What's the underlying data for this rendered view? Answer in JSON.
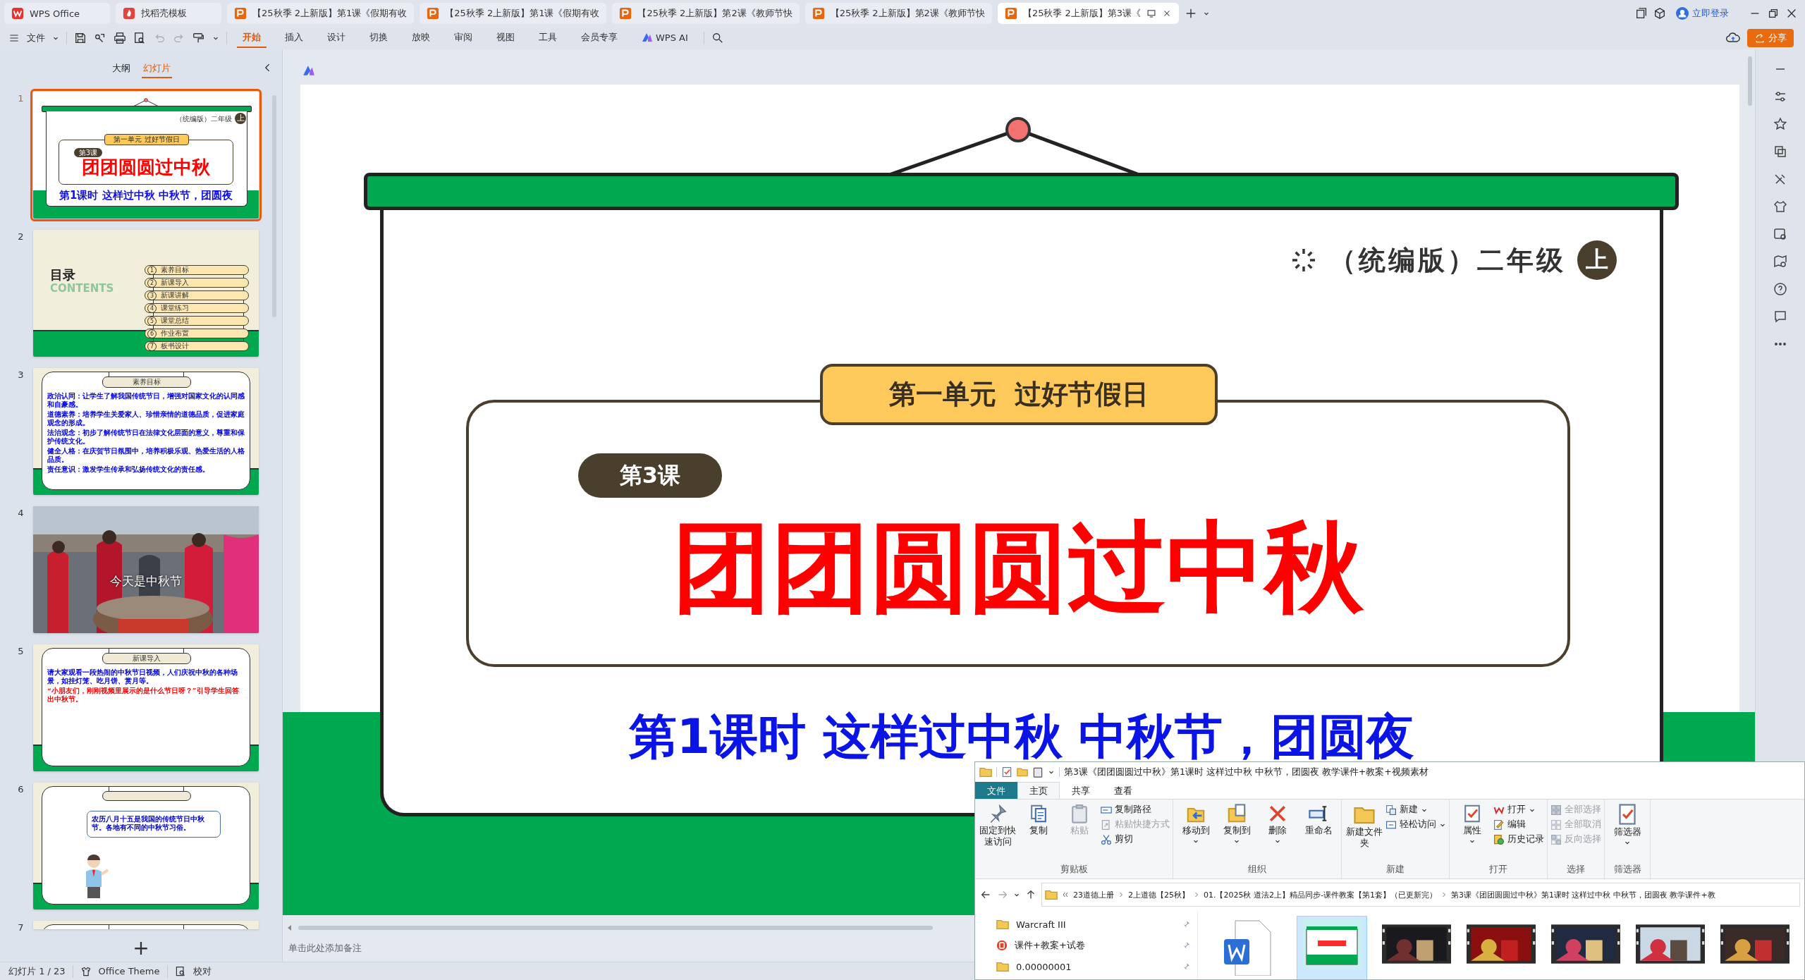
{
  "tabs": [
    {
      "label": "WPS Office",
      "kind": "app",
      "selected": false
    },
    {
      "label": "找稻壳模板",
      "kind": "template",
      "selected": false
    },
    {
      "label": "【25秋季 2上新版】第1课《假期有收",
      "kind": "doc",
      "selected": false
    },
    {
      "label": "【25秋季 2上新版】第1课《假期有收",
      "kind": "doc",
      "selected": false
    },
    {
      "label": "【25秋季 2上新版】第2课《教师节快",
      "kind": "doc",
      "selected": false
    },
    {
      "label": "【25秋季 2上新版】第2课《教师节快",
      "kind": "doc",
      "selected": false
    },
    {
      "label": "【25秋季 2上新版】第3课《",
      "kind": "doc",
      "selected": true
    }
  ],
  "toolbar": {
    "file_menu": "文件",
    "menus": [
      {
        "label": "开始",
        "selected": true
      },
      {
        "label": "插入",
        "selected": false
      },
      {
        "label": "设计",
        "selected": false
      },
      {
        "label": "切换",
        "selected": false
      },
      {
        "label": "放映",
        "selected": false
      },
      {
        "label": "审阅",
        "selected": false
      },
      {
        "label": "视图",
        "selected": false
      },
      {
        "label": "工具",
        "selected": false
      },
      {
        "label": "会员专享",
        "selected": false
      },
      {
        "label": "WPS AI",
        "selected": false
      }
    ],
    "login": "立即登录",
    "share": "分享"
  },
  "slide_panel": {
    "views": [
      {
        "label": "大纲",
        "selected": false
      },
      {
        "label": "幻灯片",
        "selected": true
      }
    ],
    "slides": [
      {
        "number": "1",
        "kind": "cover",
        "selected": true,
        "grade": "（统编版）二年级",
        "term": "上",
        "unit": "第一单元  过好节假日",
        "lesson": "第3课",
        "title": "团团圆圆过中秋",
        "subtitle": "第1课时 这样过中秋 中秋节，团圆夜"
      },
      {
        "number": "2",
        "kind": "contents",
        "selected": false,
        "heading": "目录",
        "heading_en": "CONTENTS",
        "items": [
          {
            "num": "1",
            "label": "素养目标"
          },
          {
            "num": "2",
            "label": "新课导入"
          },
          {
            "num": "3",
            "label": "新课讲解"
          },
          {
            "num": "4",
            "label": "课堂练习"
          },
          {
            "num": "5",
            "label": "课堂总结"
          },
          {
            "num": "6",
            "label": "作业布置"
          },
          {
            "num": "7",
            "label": "板书设计"
          }
        ]
      },
      {
        "number": "3",
        "kind": "lines",
        "selected": false,
        "label": "素养目标",
        "lines": [
          {
            "text": "政治认同：让学生了解我国传统节日，增强对国家文化的认同感和自豪感。",
            "color": "#0000ee"
          },
          {
            "text": "道德素养：培养学生关爱家人、珍惜亲情的道德品质，促进家庭观念的形成。",
            "color": "#0000ee"
          },
          {
            "text": "法治观念：初步了解传统节日在法律文化层面的意义，尊重和保护传统文化。",
            "color": "#0000ee"
          },
          {
            "text": "健全人格：在庆贺节日氛围中，培养积极乐观、热爱生活的人格品质。",
            "color": "#0000ee"
          },
          {
            "text": "责任意识：激发学生传承和弘扬传统文化的责任感。",
            "color": "#0000ee"
          }
        ]
      },
      {
        "number": "4",
        "selected": false,
        "caption": "今天是中秋节"
      },
      {
        "number": "5",
        "kind": "lines",
        "selected": false,
        "label": "新课导入",
        "lines": [
          {
            "text": "请大家观看一段热闹的中秋节日视频，人们庆祝中秋的各种场景，如挂灯笼、吃月饼、赏月等。",
            "color": "#0000ee"
          },
          {
            "text": "“小朋友们，刚刚视频里展示的是什么节日呀？”引导学生回答出中秋节。",
            "color": "#ff0000"
          }
        ]
      },
      {
        "number": "6",
        "kind": "dialog",
        "selected": false,
        "bubble": "农历八月十五是我国的传统节日中秋节。各地有不同的中秋节习俗。"
      },
      {
        "number": "7",
        "kind": "partial",
        "selected": false
      }
    ],
    "add_button": "+"
  },
  "slide": {
    "grade": "（统编版）二年级",
    "term": "上",
    "unit": "第一单元  过好节假日",
    "lesson": "第3课",
    "title": "团团圆圆过中秋",
    "subtitle": "第1课时 这样过中秋 中秋节，团圆夜"
  },
  "notes_placeholder": "单击此处添加备注",
  "status_bar": {
    "slide_count": "幻灯片 1 / 23",
    "theme": "Office Theme",
    "proofing": "校对"
  },
  "explorer": {
    "title": "第3课《团团圆圆过中秋》第1课时 这样过中秋 中秋节，团圆夜 教学课件+教案+视频素材",
    "tabs": [
      {
        "label": "文件",
        "kind": "file",
        "selected": false
      },
      {
        "label": "主页",
        "kind": "tab",
        "selected": true
      },
      {
        "label": "共享",
        "kind": "tab",
        "selected": false
      },
      {
        "label": "查看",
        "kind": "tab",
        "selected": false
      }
    ],
    "groups": [
      {
        "label": "剪贴板",
        "items": [
          {
            "label": "固定到快速访问",
            "kind": "large",
            "disabled": false,
            "dropdown": false
          },
          {
            "label": "复制",
            "kind": "large",
            "disabled": false,
            "dropdown": false
          },
          {
            "label": "粘贴",
            "kind": "large",
            "disabled": true,
            "dropdown": false
          },
          {
            "label": "复制路径",
            "kind": "small",
            "disabled": false,
            "dropdown": false
          },
          {
            "label": "粘贴快捷方式",
            "kind": "small",
            "disabled": true,
            "dropdown": false
          },
          {
            "label": "剪切",
            "kind": "small",
            "disabled": false,
            "dropdown": false
          }
        ]
      },
      {
        "label": "组织",
        "items": [
          {
            "label": "移动到",
            "kind": "large",
            "disabled": false,
            "dropdown": true
          },
          {
            "label": "复制到",
            "kind": "large",
            "disabled": false,
            "dropdown": true
          },
          {
            "label": "删除",
            "kind": "large",
            "disabled": false,
            "dropdown": true
          },
          {
            "label": "重命名",
            "kind": "large",
            "disabled": false,
            "dropdown": false
          }
        ]
      },
      {
        "label": "新建",
        "items": [
          {
            "label": "新建文件夹",
            "kind": "large",
            "disabled": false,
            "dropdown": false
          },
          {
            "label": "新建",
            "kind": "small",
            "disabled": false,
            "dropdown": true
          },
          {
            "label": "轻松访问",
            "kind": "small",
            "disabled": false,
            "dropdown": true
          }
        ]
      },
      {
        "label": "打开",
        "items": [
          {
            "label": "属性",
            "kind": "large",
            "disabled": false,
            "dropdown": true
          },
          {
            "label": "打开",
            "kind": "small",
            "disabled": false,
            "dropdown": true
          },
          {
            "label": "编辑",
            "kind": "small",
            "disabled": false,
            "dropdown": false
          },
          {
            "label": "历史记录",
            "kind": "small",
            "disabled": false,
            "dropdown": false
          }
        ]
      },
      {
        "label": "选择",
        "items": [
          {
            "label": "全部选择",
            "kind": "small",
            "disabled": true,
            "dropdown": false
          },
          {
            "label": "全部取消",
            "kind": "small",
            "disabled": true,
            "dropdown": false
          },
          {
            "label": "反向选择",
            "kind": "small",
            "disabled": true,
            "dropdown": false
          }
        ]
      },
      {
        "label": "筛选器",
        "items": [
          {
            "label": "筛选器",
            "kind": "large",
            "disabled": false,
            "dropdown": true
          }
        ]
      }
    ],
    "breadcrumb": [
      "23道德上册",
      "2上道德【25秋】",
      "01.【2025秋 道法2上】精品同步-课件教案【第1套】（已更新完）",
      "第3课《团团圆圆过中秋》第1课时 这样过中秋 中秋节，团圆夜 教学课件+教"
    ],
    "nav_items": [
      {
        "label": "Warcraft III",
        "kind": "folder"
      },
      {
        "label": "课件+教案+试卷",
        "kind": "app"
      },
      {
        "label": "0.00000001",
        "kind": "folder"
      }
    ],
    "files": [
      {
        "kind": "word",
        "selected": false
      },
      {
        "kind": "slides",
        "selected": true
      },
      {
        "kind": "video",
        "selected": false
      },
      {
        "kind": "video",
        "selected": false
      },
      {
        "kind": "video",
        "selected": false
      },
      {
        "kind": "video",
        "selected": false
      },
      {
        "kind": "video",
        "selected": false
      }
    ]
  }
}
